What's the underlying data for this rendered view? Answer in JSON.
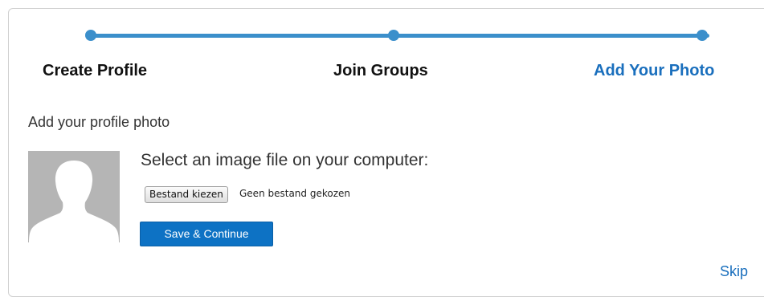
{
  "steps": [
    {
      "label": "Create Profile",
      "state": "complete"
    },
    {
      "label": "Join Groups",
      "state": "complete"
    },
    {
      "label": "Add Your Photo",
      "state": "current"
    }
  ],
  "colors": {
    "accent": "#3b8fcb",
    "active_step": "#1a6fbd",
    "primary_button": "#0d72c4",
    "avatar_bg": "#b5b5b5"
  },
  "photo": {
    "section_title": "Add your profile photo",
    "avatar_icon": "user-silhouette-icon",
    "prompt": "Select an image file on your computer:",
    "file_button_label": "Bestand kiezen",
    "file_status": "Geen bestand gekozen",
    "save_label": "Save & Continue"
  },
  "footer": {
    "skip_label": "Skip"
  }
}
